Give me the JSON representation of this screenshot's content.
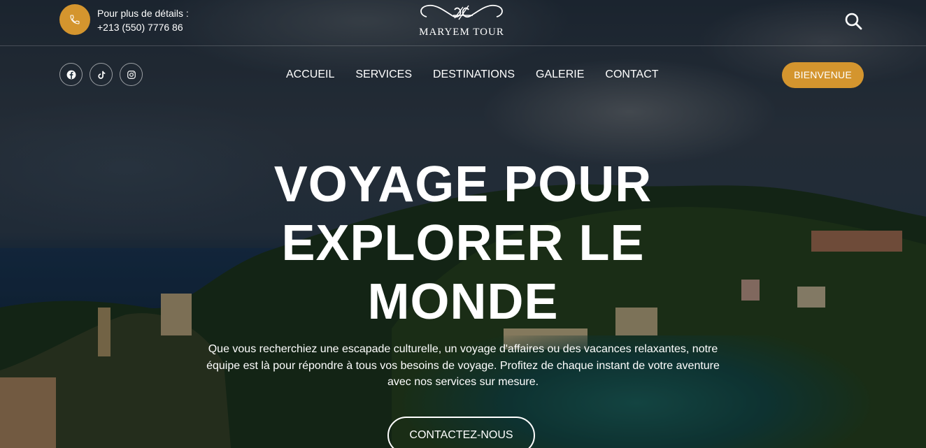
{
  "topbar": {
    "contact_label": "Pour plus de détails :",
    "phone": "+213 (550) 7776 86",
    "phone_icon": "phone-icon",
    "search_icon": "search-icon"
  },
  "logo": {
    "text": "MARYEM TOUR"
  },
  "social": [
    {
      "name": "facebook",
      "icon": "facebook-icon"
    },
    {
      "name": "tiktok",
      "icon": "tiktok-icon"
    },
    {
      "name": "instagram",
      "icon": "instagram-icon"
    }
  ],
  "nav": {
    "items": [
      "ACCUEIL",
      "SERVICES",
      "DESTINATIONS",
      "GALERIE",
      "CONTACT"
    ]
  },
  "bienvenue_button": "BIENVENUE",
  "hero": {
    "title_line1": "VOYAGE POUR",
    "title_line2": "EXPLORER LE",
    "title_line3": "MONDE",
    "description": "Que vous recherchiez une escapade culturelle, un voyage d'affaires ou des vacances relaxantes, notre équipe est là pour répondre à tous vos besoins de voyage. Profitez de chaque instant de votre aventure avec nos services sur mesure.",
    "cta": "CONTACTEZ-NOUS"
  },
  "colors": {
    "accent": "#d4952e",
    "text": "#ffffff"
  }
}
